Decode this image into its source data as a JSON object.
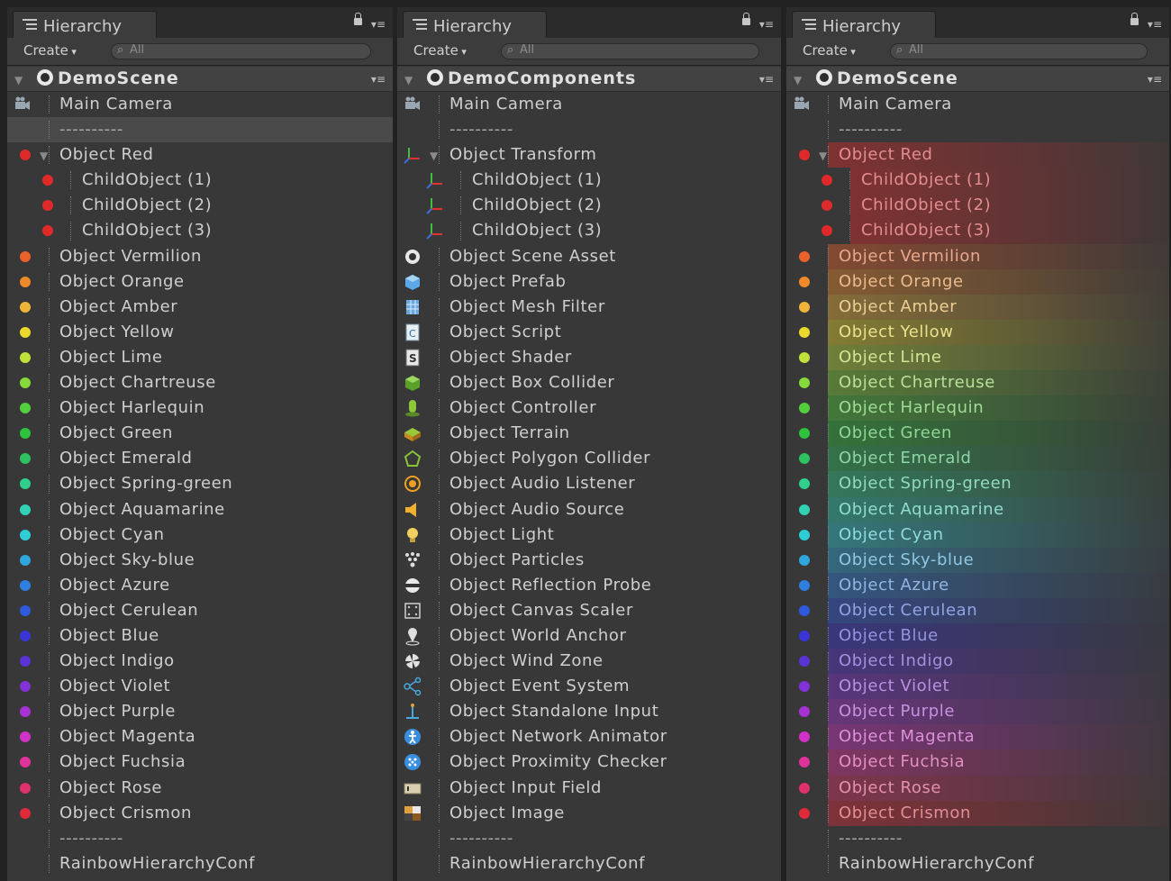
{
  "panels": [
    {
      "tab_label": "Hierarchy",
      "create_label": "Create",
      "search_placeholder": "All",
      "scene_name": "DemoScene",
      "mode": "dots",
      "rows": [
        {
          "label": "Main Camera",
          "icon": "camera-icon"
        },
        {
          "label": "----------",
          "separator": true
        },
        {
          "label": "Object Red",
          "color": "#e02a2a",
          "parent": true
        },
        {
          "label": "ChildObject (1)",
          "color": "#e02a2a",
          "child": true
        },
        {
          "label": "ChildObject (2)",
          "color": "#e02a2a",
          "child": true
        },
        {
          "label": "ChildObject (3)",
          "color": "#e02a2a",
          "child": true
        },
        {
          "label": "Object Vermilion",
          "color": "#e8622a"
        },
        {
          "label": "Object Orange",
          "color": "#ef8a2b"
        },
        {
          "label": "Object Amber",
          "color": "#f0b43a"
        },
        {
          "label": "Object Yellow",
          "color": "#ead92c"
        },
        {
          "label": "Object Lime",
          "color": "#bee23a"
        },
        {
          "label": "Object Chartreuse",
          "color": "#86d83b"
        },
        {
          "label": "Object Harlequin",
          "color": "#52cf3c"
        },
        {
          "label": "Object Green",
          "color": "#2fc23d"
        },
        {
          "label": "Object Emerald",
          "color": "#2ec15f"
        },
        {
          "label": "Object Spring-green",
          "color": "#2fd08a"
        },
        {
          "label": "Object Aquamarine",
          "color": "#2fd2b4"
        },
        {
          "label": "Object Cyan",
          "color": "#2fcdd6"
        },
        {
          "label": "Object Sky-blue",
          "color": "#2fa6dd"
        },
        {
          "label": "Object Azure",
          "color": "#2f7ee0"
        },
        {
          "label": "Object Cerulean",
          "color": "#2f5ade"
        },
        {
          "label": "Object Blue",
          "color": "#3a35d8"
        },
        {
          "label": "Object Indigo",
          "color": "#5a32d6"
        },
        {
          "label": "Object Violet",
          "color": "#8232d8"
        },
        {
          "label": "Object Purple",
          "color": "#a632d4"
        },
        {
          "label": "Object Magenta",
          "color": "#d032c8"
        },
        {
          "label": "Object Fuchsia",
          "color": "#e0329a"
        },
        {
          "label": "Object Rose",
          "color": "#e0326a"
        },
        {
          "label": "Object Crismon",
          "color": "#e02a3a"
        },
        {
          "label": "----------",
          "separator": true
        },
        {
          "label": "RainbowHierarchyConf",
          "conf": true
        }
      ]
    },
    {
      "tab_label": "Hierarchy",
      "create_label": "Create",
      "search_placeholder": "All",
      "scene_name": "DemoComponents",
      "mode": "icons",
      "rows": [
        {
          "label": "Main Camera",
          "icon": "camera-icon"
        },
        {
          "label": "----------",
          "separator": true
        },
        {
          "label": "Object Transform",
          "icon": "transform-icon",
          "color": "#e04a2a",
          "parent": true
        },
        {
          "label": "ChildObject (1)",
          "icon": "transform-icon",
          "color": "#e04a2a",
          "child": true
        },
        {
          "label": "ChildObject (2)",
          "icon": "transform-icon",
          "color": "#e04a2a",
          "child": true
        },
        {
          "label": "ChildObject (3)",
          "icon": "transform-icon",
          "color": "#e04a2a",
          "child": true
        },
        {
          "label": "Object Scene Asset",
          "icon": "scene-asset-icon",
          "color": "#e8e8e8"
        },
        {
          "label": "Object Prefab",
          "icon": "prefab-icon",
          "color": "#5aa8e8"
        },
        {
          "label": "Object Mesh Filter",
          "icon": "mesh-filter-icon",
          "color": "#6aa8e0"
        },
        {
          "label": "Object Script",
          "icon": "script-icon",
          "color": "#d8e8f0"
        },
        {
          "label": "Object Shader",
          "icon": "shader-icon",
          "color": "#e8e8e8"
        },
        {
          "label": "Object Box Collider",
          "icon": "box-collider-icon",
          "color": "#7ac23a"
        },
        {
          "label": "Object Controller",
          "icon": "controller-icon",
          "color": "#8ac83a"
        },
        {
          "label": "Object Terrain",
          "icon": "terrain-icon",
          "color": "#c8a030"
        },
        {
          "label": "Object Polygon Collider",
          "icon": "polygon-collider-icon",
          "color": "#8ac23a"
        },
        {
          "label": "Object Audio Listener",
          "icon": "audio-listener-icon",
          "color": "#f0a020"
        },
        {
          "label": "Object Audio Source",
          "icon": "audio-source-icon",
          "color": "#f0b030"
        },
        {
          "label": "Object Light",
          "icon": "light-icon",
          "color": "#f0d060"
        },
        {
          "label": "Object Particles",
          "icon": "particles-icon",
          "color": "#e0e0e0"
        },
        {
          "label": "Object Reflection Probe",
          "icon": "reflection-probe-icon",
          "color": "#e8e8e8"
        },
        {
          "label": "Object Canvas Scaler",
          "icon": "canvas-scaler-icon",
          "color": "#cfcfcf"
        },
        {
          "label": "Object World Anchor",
          "icon": "world-anchor-icon",
          "color": "#e0e0e0"
        },
        {
          "label": "Object Wind Zone",
          "icon": "wind-zone-icon",
          "color": "#e0e0e0"
        },
        {
          "label": "Object Event System",
          "icon": "event-system-icon",
          "color": "#4aa8e0"
        },
        {
          "label": "Object Standalone Input",
          "icon": "standalone-input-icon",
          "color": "#4aa8e0"
        },
        {
          "label": "Object Network Animator",
          "icon": "network-animator-icon",
          "color": "#3a8ee0"
        },
        {
          "label": "Object Proximity Checker",
          "icon": "proximity-checker-icon",
          "color": "#3a8ee0"
        },
        {
          "label": "Object Input Field",
          "icon": "input-field-icon",
          "color": "#d8d0b0"
        },
        {
          "label": "Object Image",
          "icon": "image-icon",
          "color": "#e0a040"
        },
        {
          "label": "----------",
          "separator": true
        },
        {
          "label": "RainbowHierarchyConf",
          "conf": true
        }
      ]
    },
    {
      "tab_label": "Hierarchy",
      "create_label": "Create",
      "search_placeholder": "All",
      "scene_name": "DemoScene",
      "mode": "rainbow",
      "rows": [
        {
          "label": "Main Camera",
          "icon": "camera-icon"
        },
        {
          "label": "----------",
          "separator": true
        },
        {
          "label": "Object Red",
          "color": "#e02a2a",
          "parent": true
        },
        {
          "label": "ChildObject (1)",
          "color": "#e02a2a",
          "child": true
        },
        {
          "label": "ChildObject (2)",
          "color": "#e02a2a",
          "child": true
        },
        {
          "label": "ChildObject (3)",
          "color": "#e02a2a",
          "child": true
        },
        {
          "label": "Object Vermilion",
          "color": "#e8622a"
        },
        {
          "label": "Object Orange",
          "color": "#ef8a2b"
        },
        {
          "label": "Object Amber",
          "color": "#f0b43a"
        },
        {
          "label": "Object Yellow",
          "color": "#ead92c"
        },
        {
          "label": "Object Lime",
          "color": "#bee23a"
        },
        {
          "label": "Object Chartreuse",
          "color": "#86d83b"
        },
        {
          "label": "Object Harlequin",
          "color": "#52cf3c"
        },
        {
          "label": "Object Green",
          "color": "#2fc23d"
        },
        {
          "label": "Object Emerald",
          "color": "#2ec15f"
        },
        {
          "label": "Object Spring-green",
          "color": "#2fd08a"
        },
        {
          "label": "Object Aquamarine",
          "color": "#2fd2b4"
        },
        {
          "label": "Object Cyan",
          "color": "#2fcdd6"
        },
        {
          "label": "Object Sky-blue",
          "color": "#2fa6dd"
        },
        {
          "label": "Object Azure",
          "color": "#2f7ee0"
        },
        {
          "label": "Object Cerulean",
          "color": "#2f5ade"
        },
        {
          "label": "Object Blue",
          "color": "#3a35d8"
        },
        {
          "label": "Object Indigo",
          "color": "#5a32d6"
        },
        {
          "label": "Object Violet",
          "color": "#8232d8"
        },
        {
          "label": "Object Purple",
          "color": "#a632d4"
        },
        {
          "label": "Object Magenta",
          "color": "#d032c8"
        },
        {
          "label": "Object Fuchsia",
          "color": "#e0329a"
        },
        {
          "label": "Object Rose",
          "color": "#e0326a"
        },
        {
          "label": "Object Crismon",
          "color": "#e02a3a"
        },
        {
          "label": "----------",
          "separator": true
        },
        {
          "label": "RainbowHierarchyConf",
          "conf": true
        }
      ]
    }
  ]
}
